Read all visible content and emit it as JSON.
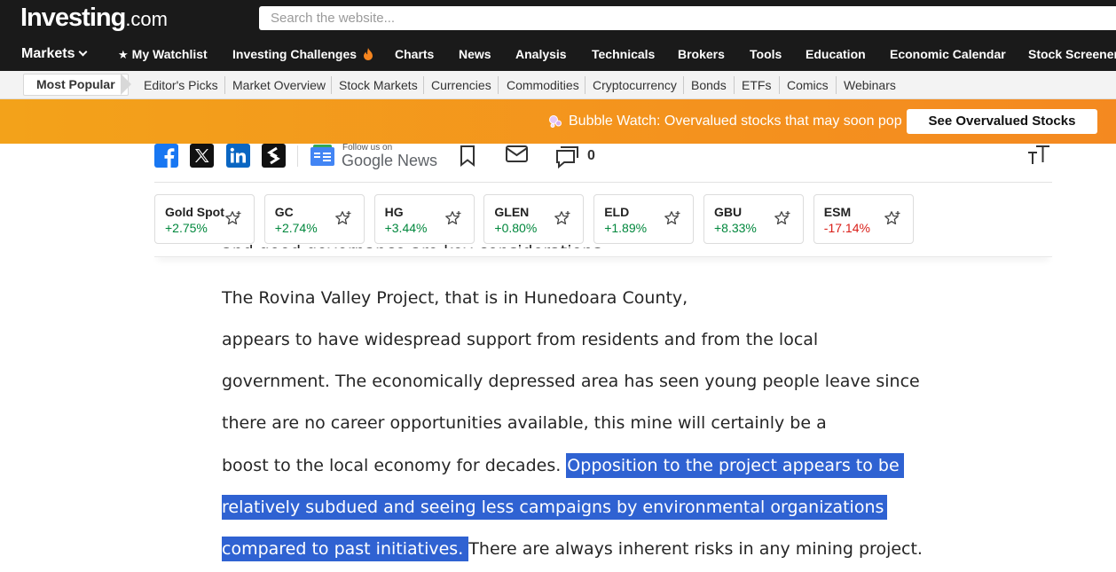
{
  "header": {
    "logo_main": "Investing",
    "logo_suffix": ".com",
    "search_placeholder": "Search the website..."
  },
  "main_nav": {
    "markets": "Markets",
    "watchlist": "My Watchlist",
    "challenges": "Investing Challenges",
    "charts": "Charts",
    "news": "News",
    "analysis": "Analysis",
    "technicals": "Technicals",
    "brokers": "Brokers",
    "tools": "Tools",
    "education": "Education",
    "economic_calendar": "Economic Calendar",
    "stock_screener": "Stock Screener"
  },
  "sub_nav": {
    "active": "Most Popular",
    "items": [
      "Editor's Picks",
      "Market Overview",
      "Stock Markets",
      "Currencies",
      "Commodities",
      "Cryptocurrency",
      "Bonds",
      "ETFs",
      "Comics",
      "Webinars"
    ]
  },
  "banner": {
    "text": "Bubble Watch: Overvalued stocks that may soon pop",
    "button": "See Overvalued Stocks"
  },
  "share": {
    "gnews_small": "Follow us on",
    "gnews_big": "Google News",
    "comment_count": "0"
  },
  "instruments": [
    {
      "symbol": "Gold Spot",
      "change": "+2.75%",
      "direction": "up"
    },
    {
      "symbol": "GC",
      "change": "+2.74%",
      "direction": "up"
    },
    {
      "symbol": "HG",
      "change": "+3.44%",
      "direction": "up"
    },
    {
      "symbol": "GLEN",
      "change": "+0.80%",
      "direction": "up"
    },
    {
      "symbol": "ELD",
      "change": "+1.89%",
      "direction": "up"
    },
    {
      "symbol": "GBU",
      "change": "+8.33%",
      "direction": "up"
    },
    {
      "symbol": "ESM",
      "change": "-17.14%",
      "direction": "down"
    }
  ],
  "article": {
    "cut_line": "and good governance are key considerations.",
    "l1": "The Rovina Valley Project, that is in Hunedoara County,",
    "l2": "appears to have widespread support from residents and from the local",
    "l3": "government. The economically depressed area has seen young people leave since",
    "l4": "there are no career opportunities available, this mine will certainly be a",
    "l5a": "boost to the local economy for decades. ",
    "l5b": "Opposition to the project appears to be",
    "l6": "relatively subdued and seeing less campaigns by environmental organizations",
    "l7a": "compared to past initiatives. ",
    "l7b": "There are always inherent risks in any mining project."
  },
  "colors": {
    "header_bg": "#1a1a1a",
    "banner_orange": "#f48920",
    "up": "#00873c",
    "down": "#d91e18",
    "selection": "#2f62d2"
  }
}
